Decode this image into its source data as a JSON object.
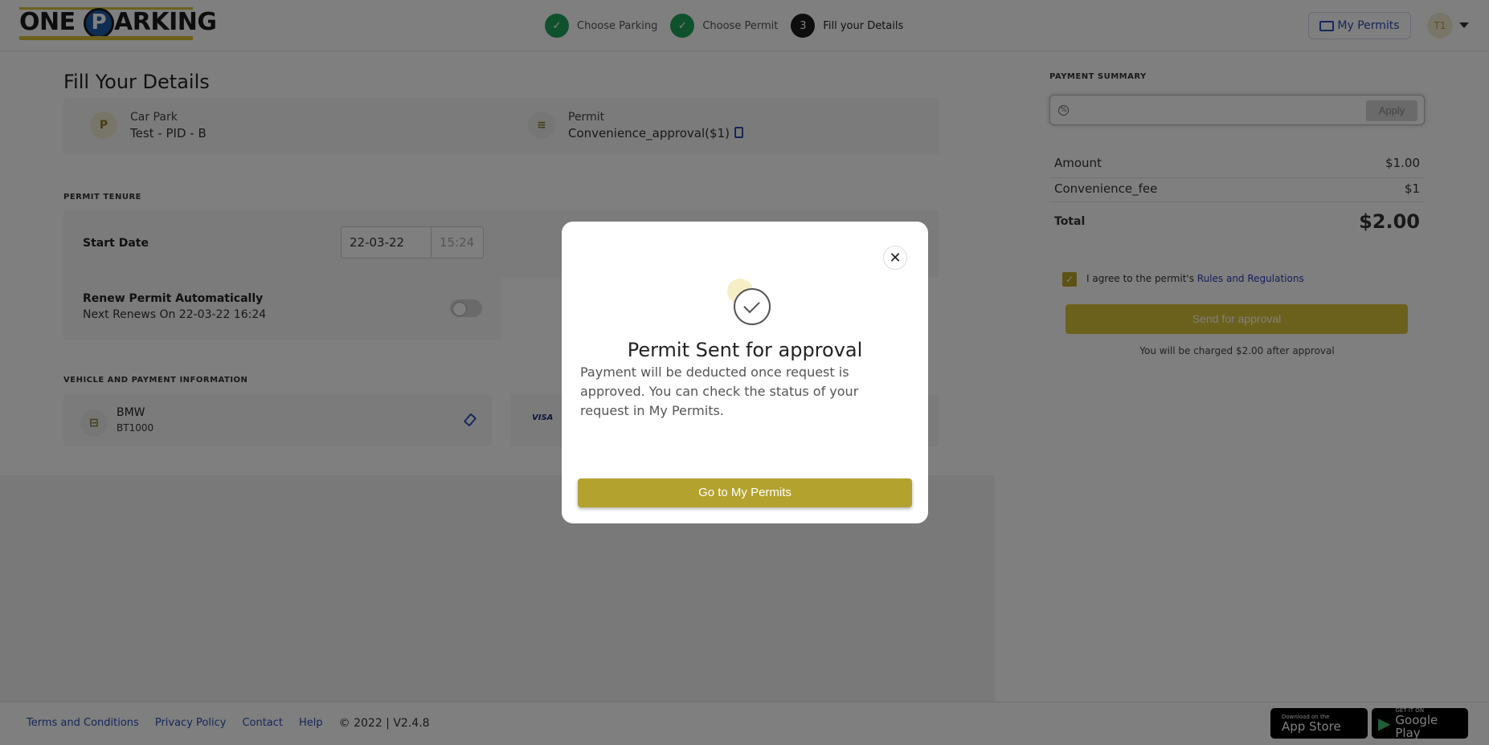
{
  "header": {
    "logo_left": "ONE",
    "logo_p": "P",
    "logo_right": "ARKING",
    "steps": [
      {
        "number": "",
        "label": "Choose Parking",
        "state": "done"
      },
      {
        "number": "",
        "label": "Choose Permit",
        "state": "done"
      },
      {
        "number": "3",
        "label": "Fill your Details",
        "state": "active"
      }
    ],
    "my_permits_label": "My Permits",
    "avatar_initials": "T1"
  },
  "main": {
    "title": "Fill Your Details",
    "car_park_label": "Car Park",
    "car_park_value": "Test - PID - B",
    "permit_label": "Permit",
    "permit_value": "Convenience_approval($1)",
    "permit_tenure_label": "PERMIT TENURE",
    "start_date_label": "Start Date",
    "start_date": "22-03-22",
    "start_time": "15:24",
    "renew_label": "Renew Permit Automatically",
    "renew_next": "Next Renews On 22-03-22 16:24",
    "vehicle_section_label": "VEHICLE AND PAYMENT INFORMATION",
    "vehicle_make": "BMW",
    "vehicle_plate": "BT1000",
    "card_brand": "VISA"
  },
  "summary": {
    "title": "PAYMENT SUMMARY",
    "promo_placeholder": "",
    "apply_label": "Apply",
    "rows": [
      {
        "label": "Amount",
        "value": "$1.00"
      },
      {
        "label": "Convenience_fee",
        "value": "$1"
      }
    ],
    "total_label": "Total",
    "total_value": "$2.00",
    "agree_text": "I agree to the permit's",
    "agree_link": "Rules and Regulations",
    "send_label": "Send for approval",
    "charge_note_pre": "You will be charged",
    "charge_note_amount": "$2.00",
    "charge_note_post": "after approval"
  },
  "footer": {
    "links": [
      "Terms and Conditions",
      "Privacy Policy",
      "Contact",
      "Help"
    ],
    "copyright": "© 2022 | V2.4.8",
    "app_store_small": "Download on the",
    "app_store_big": "App Store",
    "google_small": "GET IT ON",
    "google_big": "Google Play"
  },
  "modal": {
    "title": "Permit Sent for approval",
    "body": "Payment will be deducted once request is approved. You can check the status of your request in My Permits.",
    "button_label": "Go to My Permits",
    "close_label": "✕"
  },
  "colors": {
    "accent": "#b4a22f",
    "step_done": "#21a35a",
    "link": "#2a4fb6"
  }
}
